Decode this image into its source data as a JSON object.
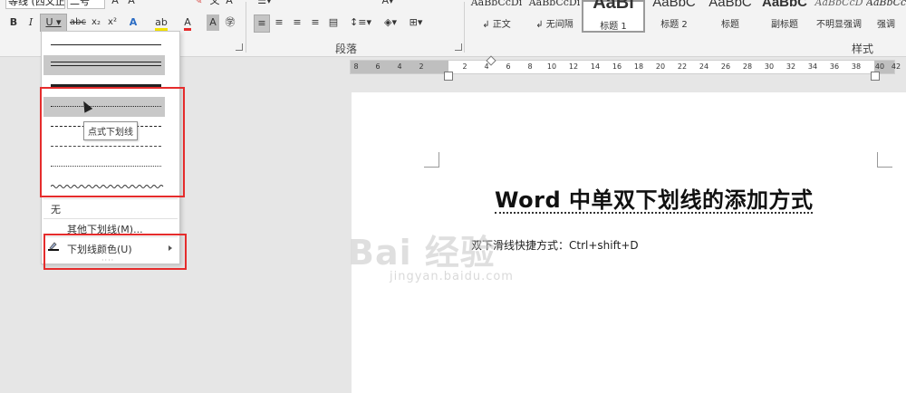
{
  "ribbon": {
    "font_name": "等线 (西文正",
    "font_size": "二号",
    "format_buttons": [
      "B",
      "I",
      "U",
      "abc",
      "x₂",
      "x²"
    ],
    "paragraph_label": "段落",
    "styles_label": "样式",
    "styles": [
      {
        "sample": "AaBbCcDı",
        "name": "↲ 正文"
      },
      {
        "sample": "AaBbCcDı",
        "name": "↲ 无间隔"
      },
      {
        "sample": "AaBl",
        "name": "标题 1"
      },
      {
        "sample": "AaBbC",
        "name": "标题 2"
      },
      {
        "sample": "AaBbC",
        "name": "标题"
      },
      {
        "sample": "AaBbC",
        "name": "副标题"
      },
      {
        "sample": "AaBbCcD",
        "name": "不明显强调"
      },
      {
        "sample": "AaBbCcD",
        "name": "强调"
      }
    ]
  },
  "ruler": {
    "ticks": [
      "8",
      "6",
      "4",
      "2",
      "",
      "2",
      "4",
      "6",
      "8",
      "10",
      "12",
      "14",
      "16",
      "18",
      "20",
      "22",
      "24",
      "26",
      "28",
      "30",
      "32",
      "34",
      "36",
      "38",
      "40",
      "42"
    ]
  },
  "underline_menu": {
    "tooltip": "点式下划线",
    "none_label": "无",
    "more_label": "其他下划线(M)...",
    "color_label": "下划线颜色(U)"
  },
  "document": {
    "title": "Word 中单双下划线的添加方式",
    "body": "双下滑线快捷方式：Ctrl+shift+D"
  },
  "watermark": {
    "brand": "Bai 经验",
    "sub": "jingyan.baidu.com"
  },
  "colors": {
    "highlight": "#e52c2c",
    "ribbon_bg": "#f3f3f3",
    "canvas_bg": "#e6e6e6"
  }
}
